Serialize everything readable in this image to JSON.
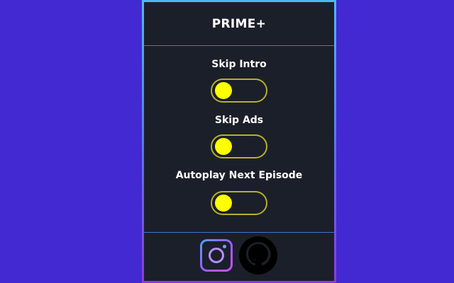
{
  "header": {
    "title": "PRIME+"
  },
  "options": [
    {
      "label": "Skip Intro",
      "enabled": false
    },
    {
      "label": "Skip Ads",
      "enabled": false
    },
    {
      "label": "Autoplay Next Episode",
      "enabled": false
    }
  ],
  "colors": {
    "background": "#4329d1",
    "panel": "#1b1f2a",
    "knob": "#ffff00",
    "toggle_border": "#b7b02a",
    "divider": "#3f76c6"
  },
  "footer": {
    "icons": [
      "instagram-icon",
      "github-icon"
    ]
  }
}
